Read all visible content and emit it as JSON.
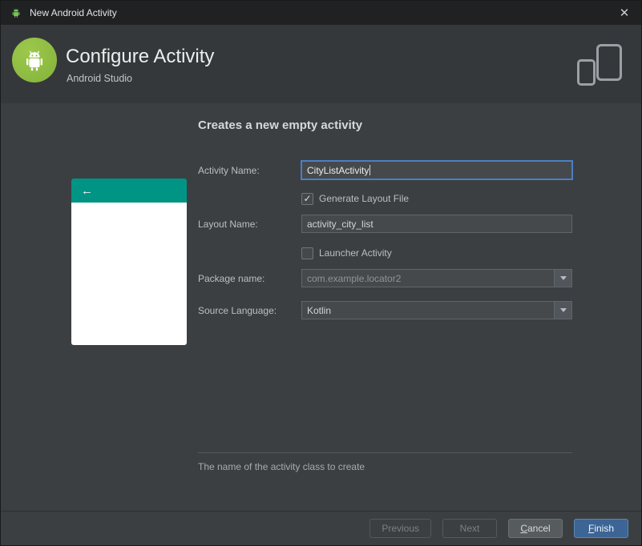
{
  "window": {
    "title": "New Android Activity",
    "close": "✕"
  },
  "header": {
    "title": "Configure Activity",
    "subtitle": "Android Studio"
  },
  "content": {
    "heading": "Creates a new empty activity",
    "hint": "The name of the activity class to create"
  },
  "preview": {
    "back_arrow": "←"
  },
  "form": {
    "activity_name": {
      "label": "Activity Name:",
      "value": "CityListActivity"
    },
    "generate_layout": {
      "label": "Generate Layout File",
      "checked": true,
      "glyph": "✓"
    },
    "layout_name": {
      "label": "Layout Name:",
      "value": "activity_city_list"
    },
    "launcher": {
      "label": "Launcher Activity",
      "checked": false,
      "glyph": ""
    },
    "package_name": {
      "label": "Package name:",
      "value": "com.example.locator2"
    },
    "source_language": {
      "label": "Source Language:",
      "value": "Kotlin"
    }
  },
  "footer": {
    "previous": "Previous",
    "next": "Next",
    "cancel_mnemonic": "C",
    "cancel_rest": "ancel",
    "finish_mnemonic": "F",
    "finish_rest": "inish"
  },
  "colors": {
    "accent_teal": "#009485",
    "focus_blue": "#4a7fc4",
    "primary_button": "#3c6595",
    "logo_green": "#8ebd3f",
    "titlebar_bg": "#1f2123",
    "header_bg": "#35383b",
    "content_bg": "#3c3f41"
  }
}
